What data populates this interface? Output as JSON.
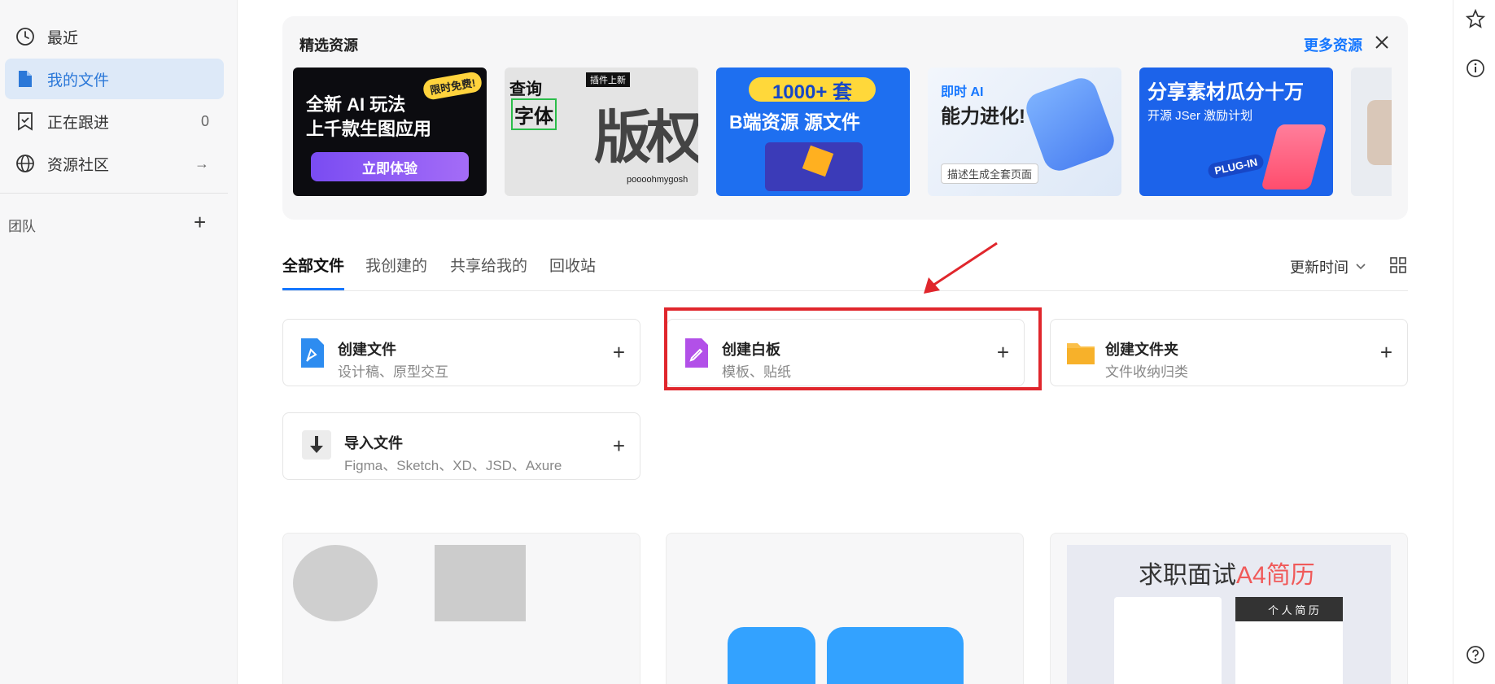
{
  "sidebar": {
    "items": [
      {
        "label": "最近",
        "icon": "clock-icon",
        "trail": ""
      },
      {
        "label": "我的文件",
        "icon": "file-icon",
        "trail": ""
      },
      {
        "label": "正在跟进",
        "icon": "bookmark-check-icon",
        "trail": "0"
      },
      {
        "label": "资源社区",
        "icon": "globe-icon",
        "trail": "→"
      }
    ],
    "team_label": "团队",
    "team_add": "+"
  },
  "featured": {
    "title": "精选资源",
    "more": "更多资源",
    "cards": [
      {
        "line1": "全新 AI 玩法",
        "line2": "上千款生图应用",
        "tag": "限时免费!",
        "button": "立即体验"
      },
      {
        "line1": "查询",
        "line2": "字体",
        "tag": "插件上新",
        "extra": "版权",
        "brand": "poooohmygosh"
      },
      {
        "line1": "1000+ 套",
        "line2": "B端资源 源文件"
      },
      {
        "line1": "即时 AI",
        "line2": "能力进化!",
        "tag": "描述生成全套页面"
      },
      {
        "line1": "分享素材瓜分十万",
        "line2": "开源 JSer 激励计划",
        "tag": "PLUG-IN"
      },
      {
        "line1": "",
        "line2": ""
      }
    ]
  },
  "tabs": [
    {
      "label": "全部文件",
      "active": true
    },
    {
      "label": "我创建的",
      "active": false
    },
    {
      "label": "共享给我的",
      "active": false
    },
    {
      "label": "回收站",
      "active": false
    }
  ],
  "sort_label": "更新时间",
  "create_cards": [
    {
      "title": "创建文件",
      "subtitle": "设计稿、原型交互",
      "icon": "design-file-icon"
    },
    {
      "title": "创建白板",
      "subtitle": "模板、贴纸",
      "icon": "whiteboard-icon"
    },
    {
      "title": "创建文件夹",
      "subtitle": "文件收纳归类",
      "icon": "folder-icon"
    },
    {
      "title": "导入文件",
      "subtitle": "Figma、Sketch、XD、JSD、Axure",
      "icon": "import-icon"
    }
  ],
  "thumbs": {
    "resume_title_a": "求职面试",
    "resume_title_b": "A4简历",
    "resume_name": "个 人 简 历"
  },
  "colors": {
    "accent": "#1677ff",
    "highlight": "#e0262c",
    "active_bg": "#dde9f8"
  }
}
